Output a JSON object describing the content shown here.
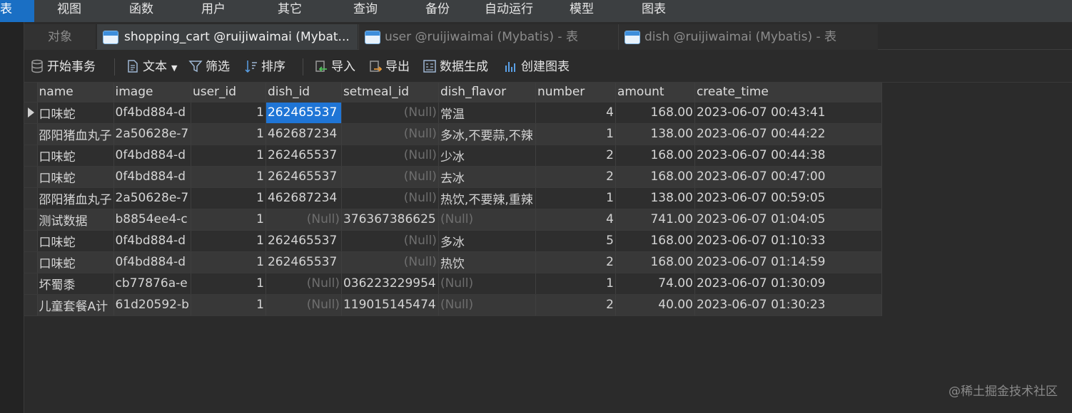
{
  "menu": {
    "left_label": "表",
    "items": [
      "视图",
      "函数",
      "用户",
      "其它",
      "查询",
      "备份",
      "自动运行",
      "模型",
      "图表"
    ]
  },
  "tabs": {
    "objects": "对象",
    "active": "shopping_cart @ruijiwaimai (Mybat...",
    "tab2": "user @ruijiwaimai (Mybatis) - 表",
    "tab3": "dish @ruijiwaimai (Mybatis) - 表"
  },
  "toolbar": {
    "begin_transaction": "开始事务",
    "text": "文本",
    "filter": "筛选",
    "sort": "排序",
    "import": "导入",
    "export": "导出",
    "data_generation": "数据生成",
    "create_chart": "创建图表"
  },
  "table": {
    "columns": [
      "name",
      "image",
      "user_id",
      "dish_id",
      "setmeal_id",
      "dish_flavor",
      "number",
      "amount",
      "create_time"
    ],
    "rows": [
      [
        "口味蛇",
        "0f4bd884-d",
        "1",
        "262465537",
        "(Null)",
        "常温",
        "4",
        "168.00",
        "2023-06-07 00:43:41"
      ],
      [
        "邵阳猪血丸子",
        "2a50628e-7",
        "1",
        "462687234",
        "(Null)",
        "多冰,不要蒜,不辣",
        "1",
        "138.00",
        "2023-06-07 00:44:22"
      ],
      [
        "口味蛇",
        "0f4bd884-d",
        "1",
        "262465537",
        "(Null)",
        "少冰",
        "2",
        "168.00",
        "2023-06-07 00:44:38"
      ],
      [
        "口味蛇",
        "0f4bd884-d",
        "1",
        "262465537",
        "(Null)",
        "去冰",
        "2",
        "168.00",
        "2023-06-07 00:47:00"
      ],
      [
        "邵阳猪血丸子",
        "2a50628e-7",
        "1",
        "462687234",
        "(Null)",
        "热饮,不要辣,重辣",
        "1",
        "138.00",
        "2023-06-07 00:59:05"
      ],
      [
        "测试数据",
        "b8854ee4-c",
        "1",
        "(Null)",
        "376367386625",
        "(Null)",
        "4",
        "741.00",
        "2023-06-07 01:04:05"
      ],
      [
        "口味蛇",
        "0f4bd884-d",
        "1",
        "262465537",
        "(Null)",
        "多冰",
        "5",
        "168.00",
        "2023-06-07 01:10:33"
      ],
      [
        "口味蛇",
        "0f4bd884-d",
        "1",
        "262465537",
        "(Null)",
        "热饮",
        "2",
        "168.00",
        "2023-06-07 01:14:59"
      ],
      [
        "坏蜀黍",
        "cb77876a-e",
        "1",
        "(Null)",
        "036223229954",
        "(Null)",
        "1",
        "74.00",
        "2023-06-07 01:30:09"
      ],
      [
        "儿童套餐A计",
        "61d20592-b",
        "1",
        "(Null)",
        "119015145474",
        "(Null)",
        "2",
        "40.00",
        "2023-06-07 01:30:23"
      ]
    ]
  },
  "watermark": "@稀土掘金技术社区",
  "colors": {
    "accent": "#1f75d6",
    "background": "#2b2b2b"
  }
}
